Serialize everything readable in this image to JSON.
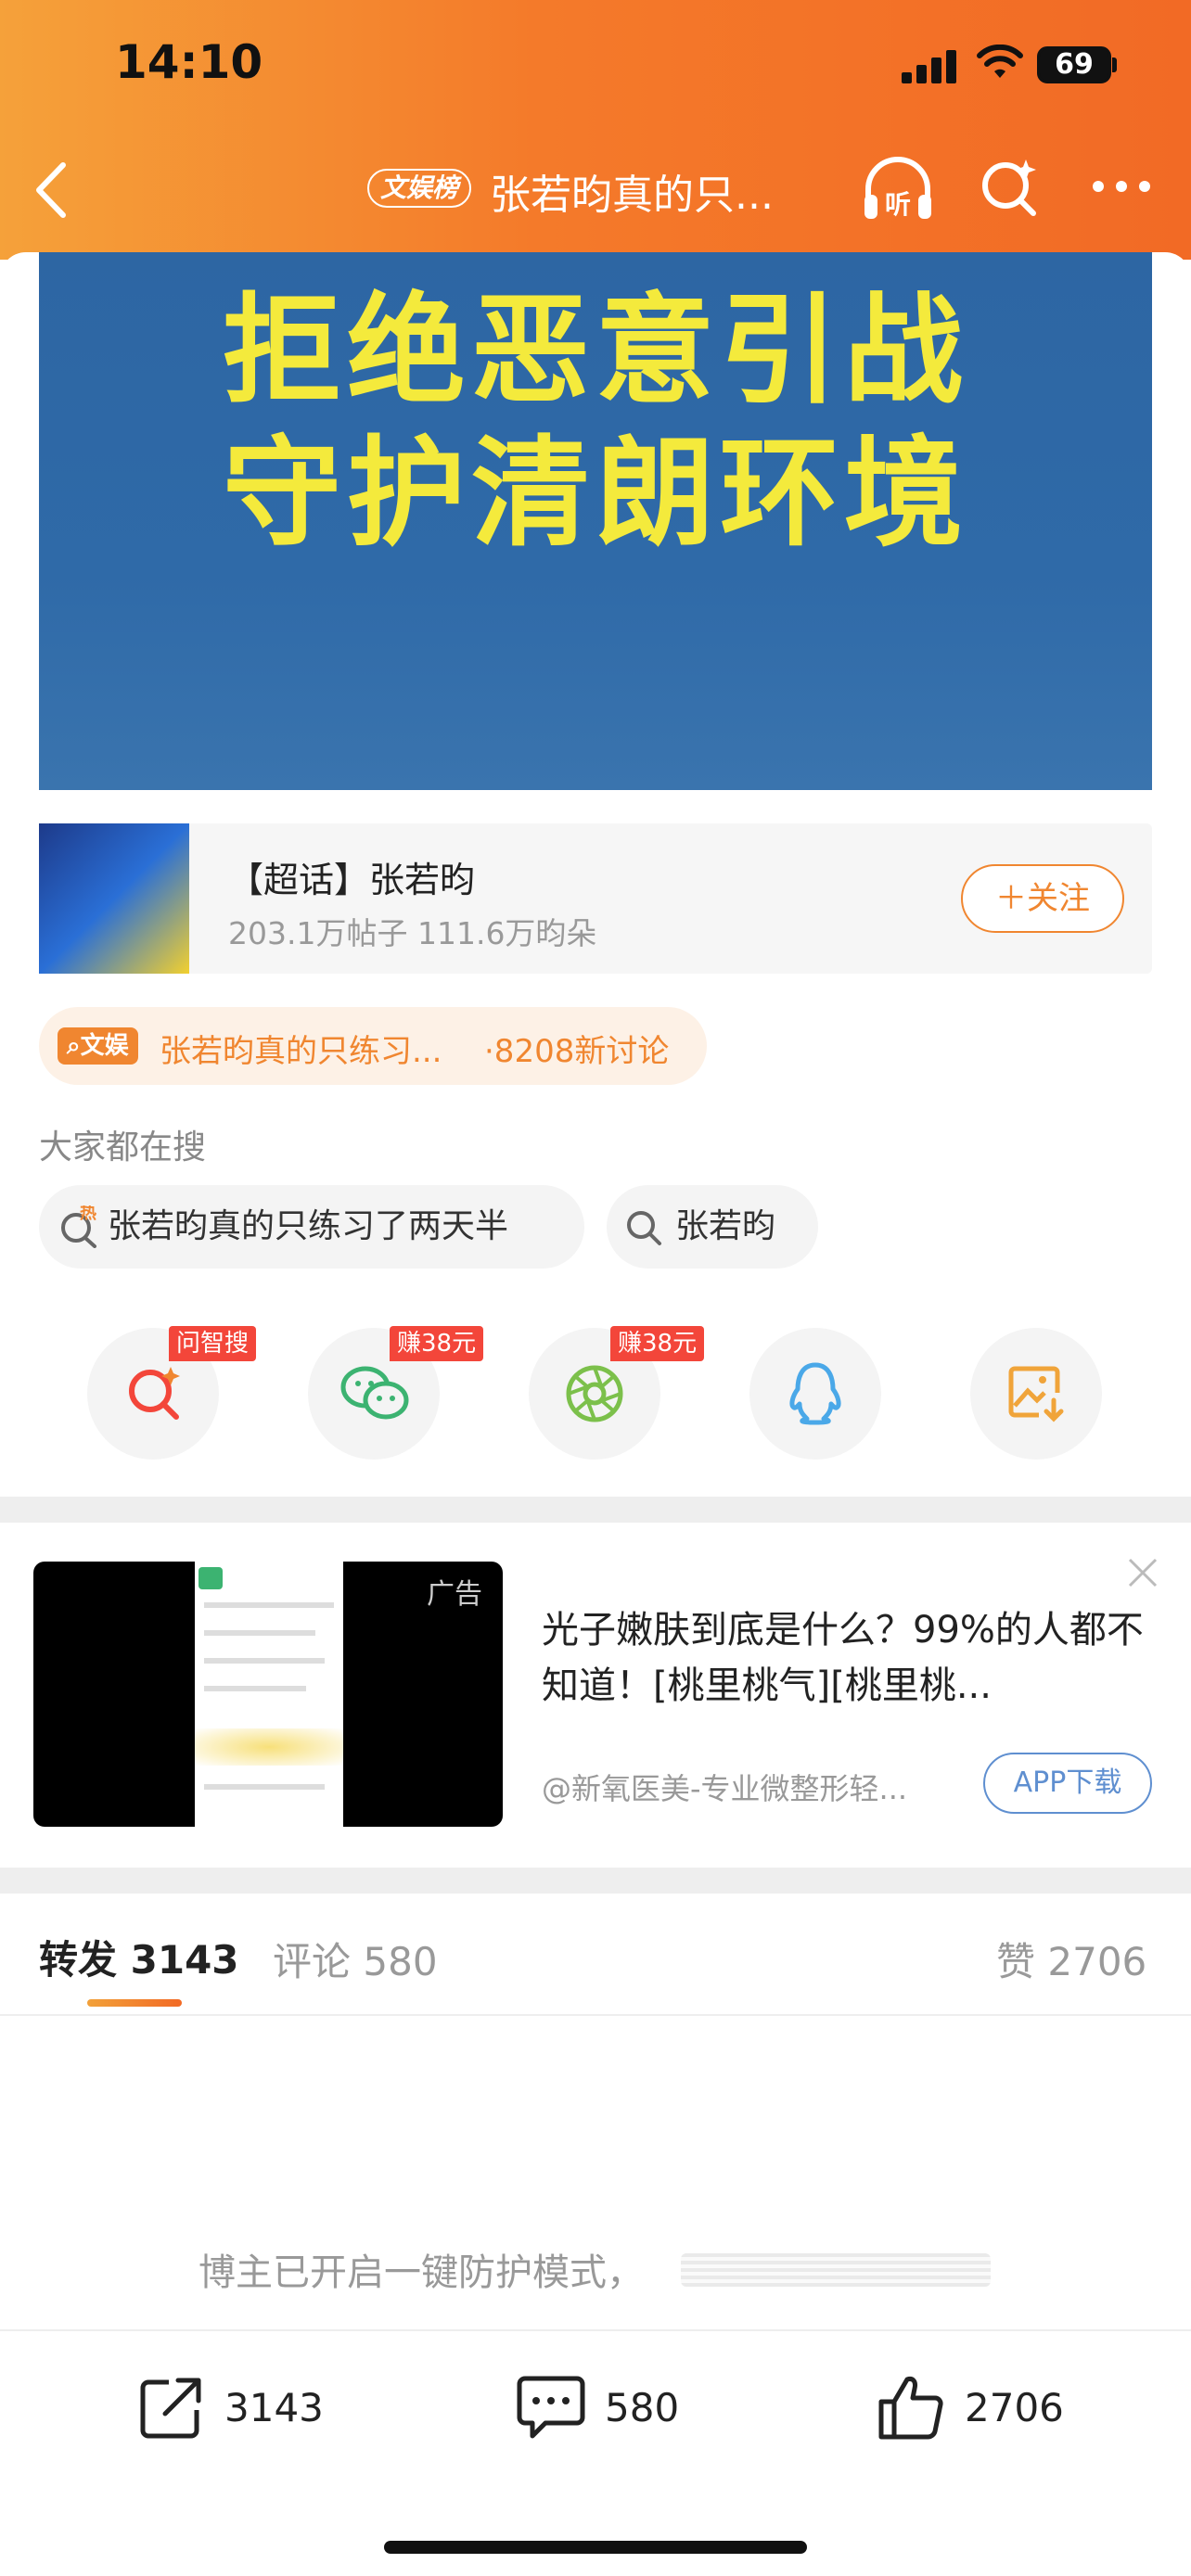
{
  "status_bar": {
    "time": "14:10",
    "battery": "69"
  },
  "header": {
    "hot_tag": "文娱榜",
    "title": "张若昀真的只..."
  },
  "banner": {
    "line1": "拒绝恶意引战",
    "line2": "守护清朗环境"
  },
  "super_topic": {
    "name": "【超话】张若昀",
    "stats": "203.1万帖子 111.6万昀朵",
    "follow_label": "＋关注"
  },
  "topic_pill": {
    "tag": "文娱",
    "text": "张若昀真的只练习...",
    "count": "·8208新讨论"
  },
  "search_section": {
    "heading": "大家都在搜",
    "chips": [
      {
        "text": "张若昀真的只练习了两天半",
        "hot": "热"
      },
      {
        "text": "张若昀"
      }
    ]
  },
  "share_row": {
    "items": [
      {
        "icon": "search-q-icon",
        "badge": "问智搜"
      },
      {
        "icon": "wechat-icon",
        "badge": "赚38元"
      },
      {
        "icon": "moments-icon",
        "badge": "赚38元"
      },
      {
        "icon": "qq-icon",
        "badge": ""
      },
      {
        "icon": "save-image-icon",
        "badge": ""
      }
    ]
  },
  "ad": {
    "label": "广告",
    "title": "光子嫩肤到底是什么？99%的人都不知道！[桃里桃气][桃里桃...",
    "source": "@新氧医美-专业微整形轻...",
    "button": "APP下载"
  },
  "tabs": {
    "repost_label": "转发",
    "repost_count": "3143",
    "comment_label": "评论",
    "comment_count": "580",
    "like_label": "赞",
    "like_count": "2706"
  },
  "protection_notice": "博主已开启一键防护模式，",
  "bottom_bar": {
    "repost": "3143",
    "comment": "580",
    "like": "2706"
  },
  "colors": {
    "accent": "#f08630",
    "header_start": "#f5a13a",
    "header_end": "#f26a25",
    "banner_bg": "#2f6aa8",
    "banner_text": "#f4ea3c"
  }
}
